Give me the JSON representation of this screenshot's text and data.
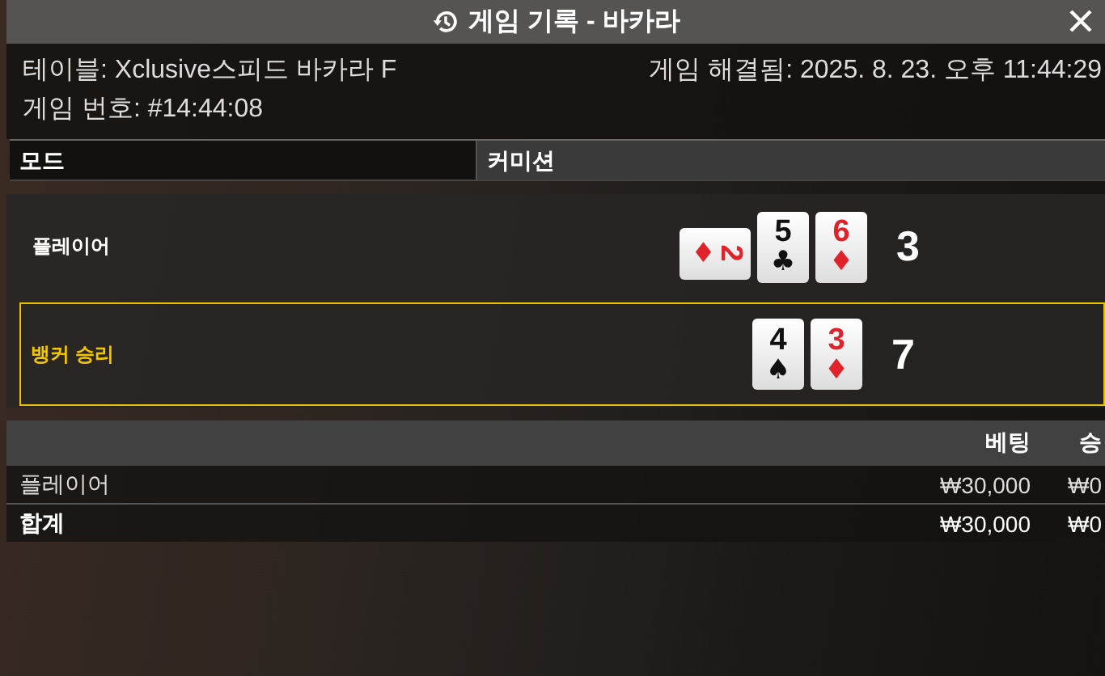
{
  "window": {
    "title": "게임 기록 - 바카라"
  },
  "info": {
    "table": "테이블: Xclusive스피드 바카라 F",
    "resolved": "게임 해결됨: 2025. 8. 23. 오후 11:44:29",
    "game_number": "게임 번호: #14:44:08"
  },
  "mode_table": {
    "columns": [
      "모드",
      "커미션"
    ]
  },
  "hands": [
    {
      "label": "플레이어",
      "winner": false,
      "score": "3",
      "cards": [
        {
          "rank": "2",
          "suit": "♦",
          "color": "#e0222a",
          "rotated": true
        },
        {
          "rank": "5",
          "suit": "♣",
          "color": "#111111",
          "rotated": false
        },
        {
          "rank": "6",
          "suit": "♦",
          "color": "#e0222a",
          "rotated": false
        }
      ]
    },
    {
      "label": "뱅커 승리",
      "winner": true,
      "score": "7",
      "cards": [
        {
          "rank": "4",
          "suit": "♠",
          "color": "#111111",
          "rotated": false
        },
        {
          "rank": "3",
          "suit": "♦",
          "color": "#e0222a",
          "rotated": false
        }
      ]
    }
  ],
  "bets": {
    "columns": [
      "",
      "베팅",
      "승"
    ],
    "rows": [
      {
        "kind": "bet",
        "cells": [
          "플레이어",
          "₩30,000",
          "₩0"
        ]
      },
      {
        "kind": "total",
        "cells": [
          "합계",
          "₩30,000",
          "₩0"
        ]
      }
    ]
  }
}
